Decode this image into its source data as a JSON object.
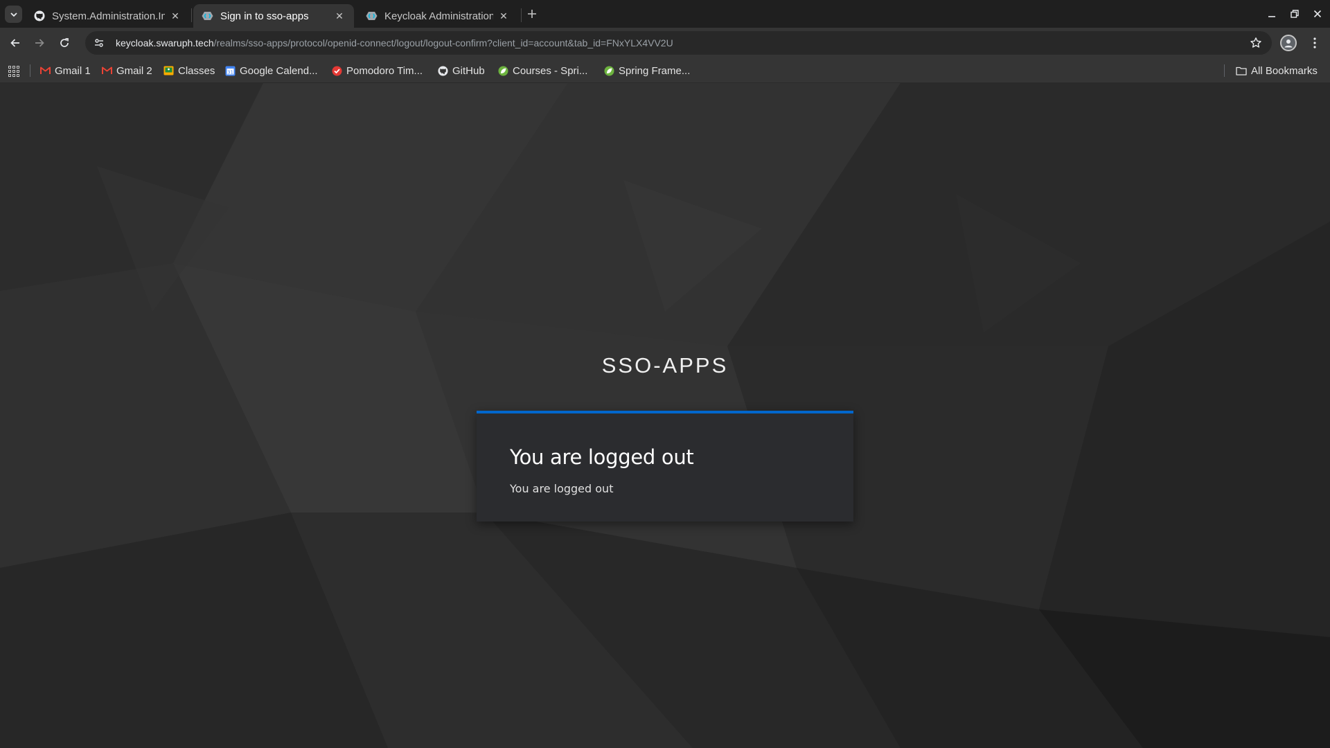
{
  "tabs": [
    {
      "title": "System.Administration.In",
      "favicon": "github-icon",
      "active": false
    },
    {
      "title": "Sign in to sso-apps",
      "favicon": "keycloak-icon",
      "active": true
    },
    {
      "title": "Keycloak Administration",
      "favicon": "keycloak-icon",
      "active": false
    }
  ],
  "toolbar": {
    "url_host": "keycloak.swaruph.tech",
    "url_path": "/realms/sso-apps/protocol/openid-connect/logout/logout-confirm?client_id=account&tab_id=FNxYLX4VV2U"
  },
  "bookmarks": [
    {
      "label": "Gmail 1",
      "icon": "gmail-icon"
    },
    {
      "label": "Gmail 2",
      "icon": "gmail-icon"
    },
    {
      "label": "Classes",
      "icon": "classroom-icon"
    },
    {
      "label": "Google Calend...",
      "icon": "calendar-icon"
    },
    {
      "label": "Pomodoro Tim...",
      "icon": "pomodoro-icon"
    },
    {
      "label": "GitHub",
      "icon": "github-icon"
    },
    {
      "label": "Courses - Spri...",
      "icon": "spring-icon"
    },
    {
      "label": "Spring Frame...",
      "icon": "spring-icon"
    }
  ],
  "all_bookmarks_label": "All Bookmarks",
  "page": {
    "realm_title": "SSO-APPS",
    "heading": "You are logged out",
    "message": "You are logged out"
  },
  "colors": {
    "accent": "#0066cc",
    "card_bg": "#2b2c2f",
    "page_bg": "#2e2e2e"
  }
}
